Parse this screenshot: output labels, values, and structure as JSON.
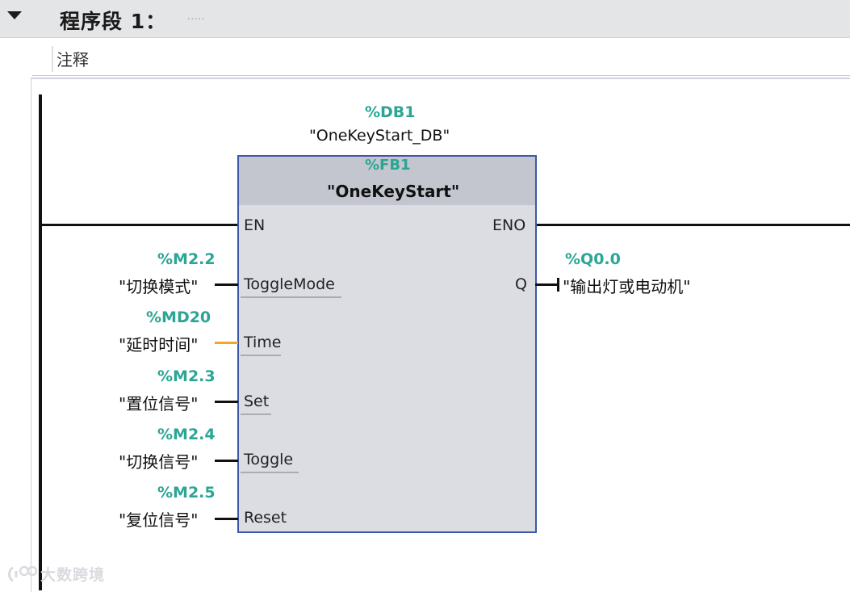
{
  "network": {
    "title": "程序段 1：",
    "title_placeholder": ".....",
    "comment": "注释"
  },
  "block": {
    "instance_db_address": "%DB1",
    "instance_db_name": "\"OneKeyStart_DB\"",
    "fb_address": "%FB1",
    "fb_name": "\"OneKeyStart\"",
    "pins": {
      "en": "EN",
      "eno": "ENO",
      "toggle_mode": "ToggleMode",
      "time": "Time",
      "set": "Set",
      "toggle": "Toggle",
      "reset": "Reset",
      "q": "Q"
    }
  },
  "inputs": [
    {
      "address": "%M2.2",
      "symbol": "\"切换模式\""
    },
    {
      "address": "%MD20",
      "symbol": "\"延时时间\""
    },
    {
      "address": "%M2.3",
      "symbol": "\"置位信号\""
    },
    {
      "address": "%M2.4",
      "symbol": "\"切换信号\""
    },
    {
      "address": "%M2.5",
      "symbol": "\"复位信号\""
    }
  ],
  "output": {
    "address": "%Q0.0",
    "symbol": "\"输出灯或电动机\""
  },
  "colors": {
    "address_text": "#2ba594",
    "block_border": "#3c57a6",
    "time_wire": "#f5a623"
  },
  "watermark": "大数跨境"
}
